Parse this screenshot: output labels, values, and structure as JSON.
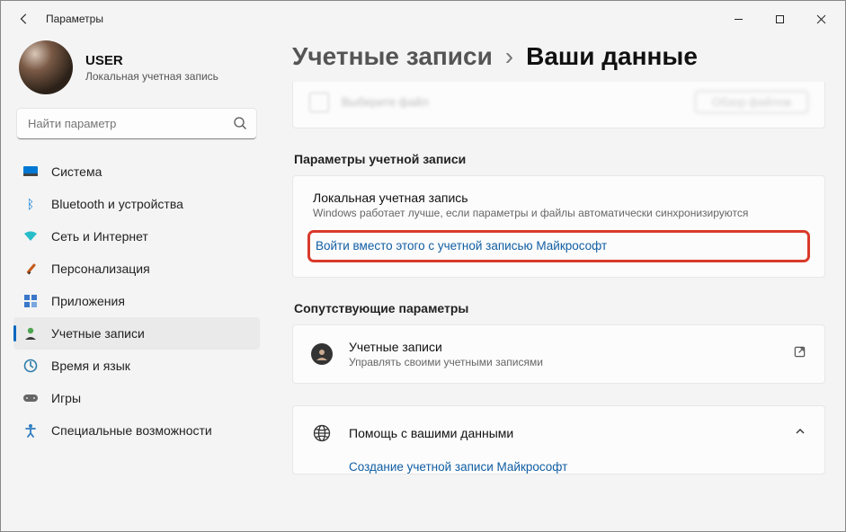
{
  "window": {
    "app_title": "Параметры"
  },
  "profile": {
    "name": "USER",
    "subtitle": "Локальная учетная запись"
  },
  "search": {
    "placeholder": "Найти параметр"
  },
  "nav": {
    "items": [
      {
        "label": "Система"
      },
      {
        "label": "Bluetooth и устройства"
      },
      {
        "label": "Сеть и Интернет"
      },
      {
        "label": "Персонализация"
      },
      {
        "label": "Приложения"
      },
      {
        "label": "Учетные записи"
      },
      {
        "label": "Время и язык"
      },
      {
        "label": "Игры"
      },
      {
        "label": "Специальные возможности"
      }
    ]
  },
  "breadcrumb": {
    "parent": "Учетные записи",
    "current": "Ваши данные"
  },
  "partial_card": {
    "text": "Выберите файл",
    "button": "Обзор файлов"
  },
  "sections": {
    "account_params": "Параметры учетной записи",
    "related": "Сопутствующие параметры"
  },
  "account_card": {
    "title": "Локальная учетная запись",
    "subtitle": "Windows работает лучше, если параметры и файлы автоматически синхронизируются",
    "signin_link": "Войти вместо этого с учетной записью Майкрософт"
  },
  "related_card": {
    "title": "Учетные записи",
    "subtitle": "Управлять своими учетными записями"
  },
  "help_card": {
    "title": "Помощь с вашими данными",
    "link": "Создание учетной записи Майкрософт"
  }
}
